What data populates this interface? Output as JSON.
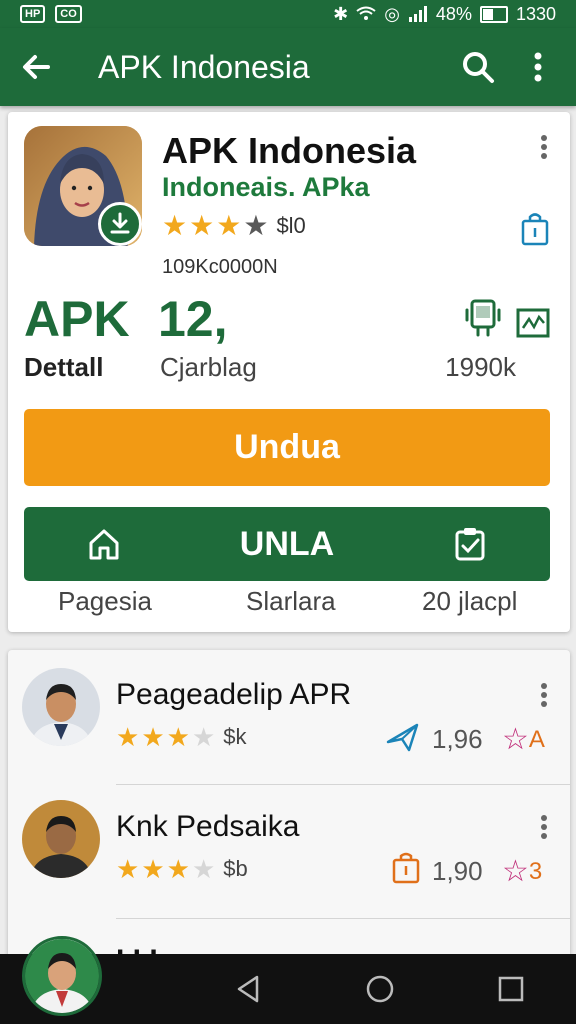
{
  "status_bar": {
    "left_chips": [
      "HP",
      "CO"
    ],
    "battery": "48%",
    "time": "1330"
  },
  "app_bar": {
    "title": "APK Indonesia",
    "icons": [
      "back-arrow-icon",
      "search-icon",
      "more-vert-icon"
    ]
  },
  "app": {
    "name": "APK Indonesia",
    "developer": "Indoneais. APka",
    "rating_stars": 3,
    "rating_text": "$l0",
    "downloads": "109Kc0000N",
    "stats": [
      {
        "value": "APK",
        "label": "Dettall"
      },
      {
        "value": "12,",
        "label": "Cjarblag"
      },
      {
        "value": "",
        "label": "1990k"
      }
    ],
    "install_label": "Undua",
    "secondary_label": "UNLA",
    "bottom_labels": [
      "Pagesia",
      "Slarlara",
      "20 jlacpl"
    ]
  },
  "list": {
    "items": [
      {
        "title": "Peageadelip APR",
        "stars": 3,
        "rating_text": "$k",
        "count": "1,96",
        "badge": "A",
        "badge_color": "#c02f7a",
        "left_icon": "send-icon"
      },
      {
        "title": "Knk Pedsaika",
        "stars": 3,
        "rating_text": "$b",
        "count": "1,90",
        "badge": "3",
        "badge_color": "#e0701a",
        "left_icon": "bag-icon"
      }
    ],
    "partial_item_title": "I I     I"
  },
  "colors": {
    "primary": "#1e6b3a",
    "accent": "#f29a14",
    "star": "#f2a81d"
  }
}
